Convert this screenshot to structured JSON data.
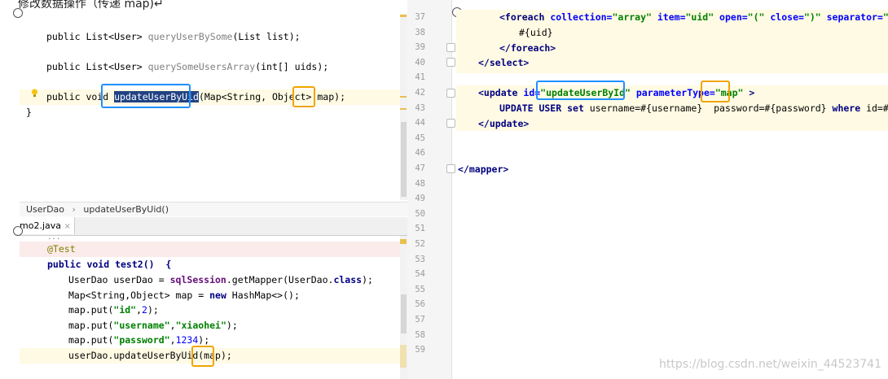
{
  "doc_title": "修改数据操作（传递 map)↵",
  "interface_lines": [
    {
      "ret": "public List<User> ",
      "name": "queryUserBySome",
      "args": "(List list);"
    },
    {
      "ret": "public List<User> ",
      "name": "querySomeUsersArray",
      "args": "(int[] uids);"
    }
  ],
  "update_decl": {
    "prefix": "public void ",
    "name": "updateUserByUid",
    "args": "(Map<String, Object> ",
    "param": "map",
    "suffix": ");"
  },
  "closing_brace": "}",
  "breadcrumb": {
    "item1": "UserDao",
    "sep": "›",
    "item2": "updateUserByUid()"
  },
  "tab": {
    "label": "mo2.java",
    "close": "×"
  },
  "test_code": {
    "dots": "...",
    "annotation": "@Test",
    "decl": "public void test2()  {",
    "line1a": "UserDao userDao = ",
    "line1b": "sqlSession",
    "line1c": ".getMapper(UserDao.",
    "line1d": "class",
    "line1e": ");",
    "line2a": "Map<String,Object> map = ",
    "line2b": "new",
    "line2c": " HashMap<>();",
    "put1": {
      "pre": "map.put(",
      "key": "\"id\"",
      "sep": ",",
      "val": "2",
      "post": ");"
    },
    "put2": {
      "pre": "map.put(",
      "key": "\"username\"",
      "sep": ",",
      "val": "\"xiaohei\"",
      "post": ");"
    },
    "put3": {
      "pre": "map.put(",
      "key": "\"password\"",
      "sep": ",",
      "val": "1234",
      "post": ");"
    },
    "call_pre": "userDao.updateUserByUid(",
    "call_param": "map",
    "call_post": ");"
  },
  "line_numbers": [
    "37",
    "38",
    "39",
    "40",
    "41",
    "42",
    "43",
    "44",
    "45",
    "46",
    "47",
    "48",
    "49",
    "50",
    "51",
    "52",
    "53",
    "54",
    "55",
    "56",
    "57",
    "58",
    "59"
  ],
  "xml": {
    "foreach": {
      "open": "<foreach ",
      "a1": "collection=",
      "v1": "\"array\"",
      "a2": " item=",
      "v2": "\"uid\"",
      "a3": " open=",
      "v3": "\"(\"",
      "a4": " close=",
      "v4": "\")\"",
      "a5": " separator=",
      "v5": "\",\"",
      "end": ">"
    },
    "uid_expr": "#{uid}",
    "foreach_close": "</foreach>",
    "select_close": "</select>",
    "update": {
      "open": "<update ",
      "a1": "id=",
      "v1": "\"updateUserById\"",
      "a2": " parameterType=",
      "v2": "\"map\"",
      "end": " >"
    },
    "sql": {
      "k1": "UPDATE USER ",
      "k2": "set",
      "t1": " username=#{username}  password=#{password} ",
      "k3": "where",
      "t2": " id=#{id}"
    },
    "update_close": "</update>",
    "mapper_close": "</mapper>"
  },
  "watermark": "https://blog.csdn.net/weixin_44523741"
}
